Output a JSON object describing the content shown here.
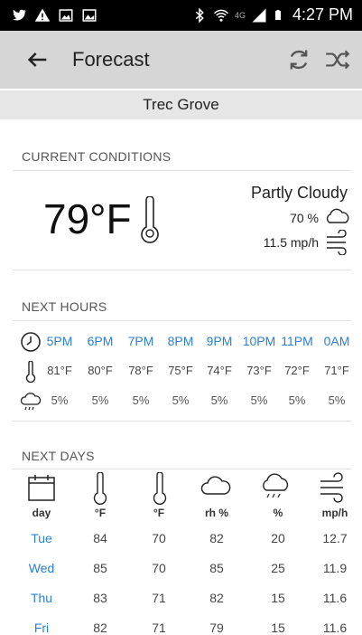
{
  "status_bar": {
    "time": "4:27 PM",
    "network": "4G"
  },
  "app_bar": {
    "title": "Forecast"
  },
  "location": "Trec Grove",
  "current": {
    "heading": "CURRENT CONDITIONS",
    "temperature": "79°F",
    "condition": "Partly Cloudy",
    "humidity": "70 %",
    "wind": "11.5 mp/h"
  },
  "next_hours": {
    "heading": "NEXT HOURS",
    "times": [
      "5PM",
      "6PM",
      "7PM",
      "8PM",
      "9PM",
      "10PM",
      "11PM",
      "0AM"
    ],
    "temps": [
      "81°F",
      "80°F",
      "78°F",
      "75°F",
      "74°F",
      "73°F",
      "72°F",
      "71°F"
    ],
    "rain": [
      "5%",
      "5%",
      "5%",
      "5%",
      "5%",
      "5%",
      "5%",
      "5%"
    ]
  },
  "next_days": {
    "heading": "NEXT DAYS",
    "columns": [
      "day",
      "°F",
      "°F",
      "rh %",
      "%",
      "mp/h"
    ],
    "rows": [
      [
        "Tue",
        "84",
        "70",
        "82",
        "20",
        "12.7"
      ],
      [
        "Wed",
        "85",
        "70",
        "85",
        "25",
        "11.9"
      ],
      [
        "Thu",
        "83",
        "71",
        "82",
        "15",
        "11.6"
      ],
      [
        "Fri",
        "82",
        "71",
        "79",
        "15",
        "11.6"
      ]
    ]
  },
  "colors": {
    "accent": "#2a7fd4",
    "app_bar": "#d6d6d6",
    "location_bar": "#e6e6e6"
  }
}
